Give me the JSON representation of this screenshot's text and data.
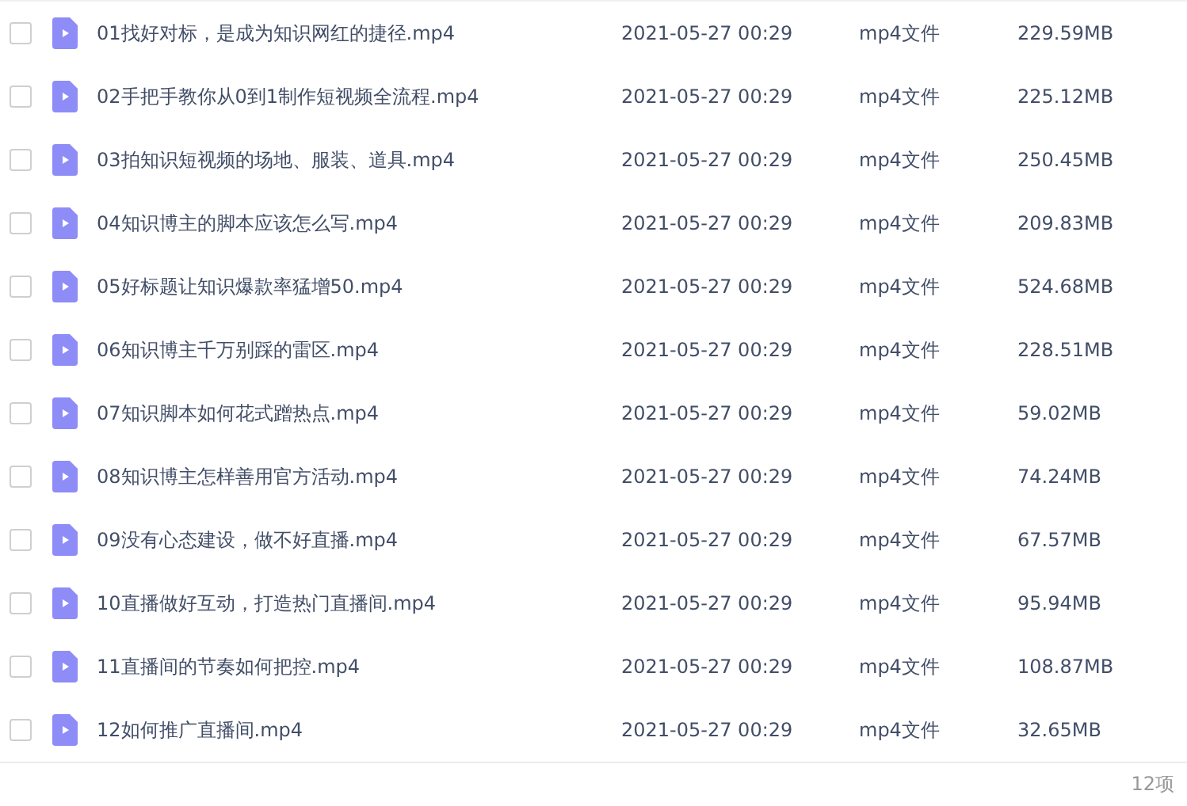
{
  "files": [
    {
      "name": "01找好对标，是成为知识网红的捷径.mp4",
      "date": "2021-05-27 00:29",
      "type": "mp4文件",
      "size": "229.59MB",
      "checked": false
    },
    {
      "name": "02手把手教你从0到1制作短视频全流程.mp4",
      "date": "2021-05-27 00:29",
      "type": "mp4文件",
      "size": "225.12MB",
      "checked": false
    },
    {
      "name": "03拍知识短视频的场地、服装、道具.mp4",
      "date": "2021-05-27 00:29",
      "type": "mp4文件",
      "size": "250.45MB",
      "checked": false
    },
    {
      "name": "04知识博主的脚本应该怎么写.mp4",
      "date": "2021-05-27 00:29",
      "type": "mp4文件",
      "size": "209.83MB",
      "checked": false
    },
    {
      "name": "05好标题让知识爆款率猛增50.mp4",
      "date": "2021-05-27 00:29",
      "type": "mp4文件",
      "size": "524.68MB",
      "checked": false
    },
    {
      "name": "06知识博主千万别踩的雷区.mp4",
      "date": "2021-05-27 00:29",
      "type": "mp4文件",
      "size": "228.51MB",
      "checked": false
    },
    {
      "name": "07知识脚本如何花式蹭热点.mp4",
      "date": "2021-05-27 00:29",
      "type": "mp4文件",
      "size": "59.02MB",
      "checked": false
    },
    {
      "name": "08知识博主怎样善用官方活动.mp4",
      "date": "2021-05-27 00:29",
      "type": "mp4文件",
      "size": "74.24MB",
      "checked": false
    },
    {
      "name": "09没有心态建设，做不好直播.mp4",
      "date": "2021-05-27 00:29",
      "type": "mp4文件",
      "size": "67.57MB",
      "checked": false
    },
    {
      "name": "10直播做好互动，打造热门直播间.mp4",
      "date": "2021-05-27 00:29",
      "type": "mp4文件",
      "size": "95.94MB",
      "checked": false
    },
    {
      "name": "11直播间的节奏如何把控.mp4",
      "date": "2021-05-27 00:29",
      "type": "mp4文件",
      "size": "108.87MB",
      "checked": false
    },
    {
      "name": "12如何推广直播间.mp4",
      "date": "2021-05-27 00:29",
      "type": "mp4文件",
      "size": "32.65MB",
      "checked": false
    }
  ],
  "footer": {
    "count": "12项"
  }
}
